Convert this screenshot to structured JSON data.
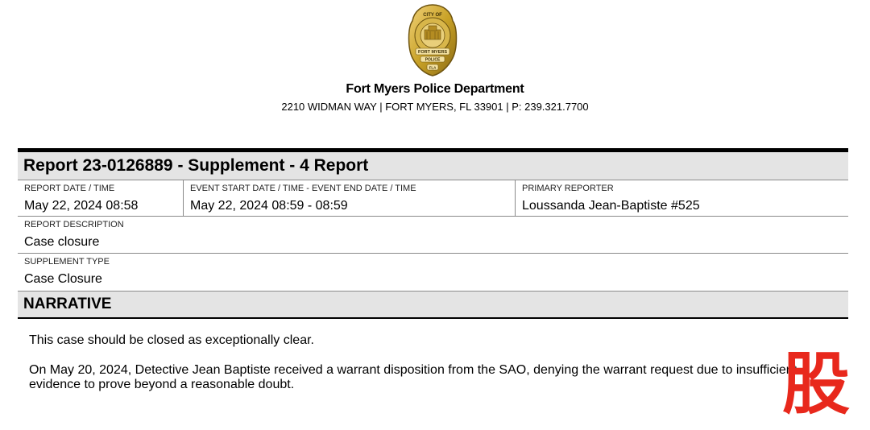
{
  "header": {
    "badge_text": {
      "top": "CITY OF",
      "city": "FORT MYERS",
      "agency": "POLICE",
      "state": "FLA"
    },
    "department": "Fort Myers Police Department",
    "address": "2210 WIDMAN WAY | FORT MYERS, FL 33901 | P: 239.321.7700"
  },
  "report": {
    "title": "Report 23-0126889 - Supplement - 4 Report",
    "fields": {
      "report_date_label": "REPORT DATE / TIME",
      "report_date_value": "May 22, 2024 08:58",
      "event_date_label": "EVENT START DATE / TIME - EVENT END DATE / TIME",
      "event_date_value": "May 22, 2024 08:59 - 08:59",
      "primary_reporter_label": "PRIMARY REPORTER",
      "primary_reporter_value": "Loussanda Jean-Baptiste #525",
      "description_label": "REPORT DESCRIPTION",
      "description_value": "Case closure",
      "supplement_type_label": "SUPPLEMENT TYPE",
      "supplement_type_value": "Case Closure"
    }
  },
  "narrative": {
    "title": "NARRATIVE",
    "paragraphs": [
      "This case should be closed as exceptionally clear.",
      "On May 20, 2024, Detective Jean Baptiste received a warrant disposition from the SAO, denying the warrant request due to insufficient evidence to prove beyond a reasonable doubt."
    ]
  },
  "watermark": {
    "glyph": "股",
    "color": "#e8281c"
  },
  "colors": {
    "section_bar": "#e4e4e4",
    "badge_gold": "#c9a227"
  }
}
